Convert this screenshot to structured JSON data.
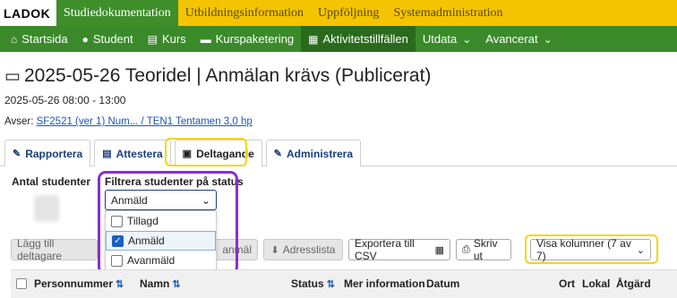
{
  "app": {
    "logo": "LADOK"
  },
  "topnav": [
    {
      "label": "Studiedokumentation",
      "active": true
    },
    {
      "label": "Utbildningsinformation",
      "active": false
    },
    {
      "label": "Uppföljning",
      "active": false
    },
    {
      "label": "Systemadministration",
      "active": false
    }
  ],
  "mainnav": [
    {
      "label": "Startsida",
      "icon": "home-icon"
    },
    {
      "label": "Student",
      "icon": "user-icon"
    },
    {
      "label": "Kurs",
      "icon": "book-icon"
    },
    {
      "label": "Kurspaketering",
      "icon": "folder-icon"
    },
    {
      "label": "Aktivitetstillfällen",
      "icon": "calendar-icon",
      "active": true
    },
    {
      "label": "Utdata",
      "icon": "chevron-down-icon"
    },
    {
      "label": "Avancerat",
      "icon": "chevron-down-icon"
    }
  ],
  "page": {
    "title": "2025-05-26 Teoridel | Anmälan krävs (Publicerat)",
    "datetime": "2025-05-26 08:00 - 13:00",
    "avser_label": "Avser: ",
    "avser_link1": "SF2521 (ver 1) Num... / TEN1 Tentamen 3,0 hp"
  },
  "tabs": [
    {
      "label": "Rapportera",
      "icon": "pencil-icon"
    },
    {
      "label": "Attestera",
      "icon": "list-icon"
    },
    {
      "label": "Deltagande",
      "icon": "archive-icon",
      "active": true
    },
    {
      "label": "Administrera",
      "icon": "pencil-icon"
    }
  ],
  "filter": {
    "antal_label": "Antal studenter",
    "filter_label": "Filtrera studenter på status",
    "selected": "Anmäld",
    "options": [
      {
        "label": "Tillagd",
        "checked": false
      },
      {
        "label": "Anmäld",
        "checked": true
      },
      {
        "label": "Avanmäld",
        "checked": false
      }
    ]
  },
  "buttons": {
    "add": "Lägg till deltagare",
    "hidden_partial": "anmäl",
    "address": "Adresslista",
    "export": "Exportera till CSV",
    "print": "Skriv ut",
    "columns": "Visa kolumner (7 av 7)"
  },
  "table": {
    "headers": [
      "Personnummer",
      "Namn",
      "Status",
      "Mer information",
      "Datum",
      "Ort",
      "Lokal",
      "Åtgärd"
    ]
  },
  "colors": {
    "topbar": "#f4c400",
    "nav": "#3a8a2a",
    "highlight_yellow": "#f5d60a",
    "highlight_purple": "#8b2cd4"
  }
}
